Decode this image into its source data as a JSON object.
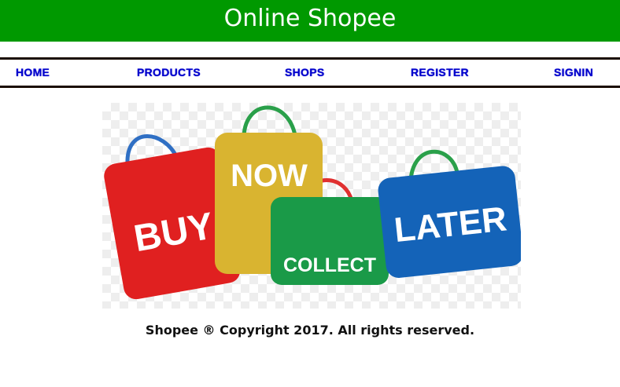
{
  "header": {
    "title": "Online Shopee",
    "bg_color": "#009900"
  },
  "nav": {
    "items": [
      {
        "label": "HOME"
      },
      {
        "label": "PRODUCTS"
      },
      {
        "label": "SHOPS"
      },
      {
        "label": "REGISTER"
      },
      {
        "label": "SIGNIN"
      }
    ],
    "link_color": "#0000cc"
  },
  "banner": {
    "bags": [
      {
        "word": "BUY",
        "color": "#e02020"
      },
      {
        "word": "NOW",
        "color": "#d9b430"
      },
      {
        "word": "COLLECT",
        "color": "#1a9a48"
      },
      {
        "word": "LATER",
        "color": "#1463b8"
      }
    ],
    "handle_colors": [
      "#2f6fc4",
      "#2aa04a",
      "#e03030",
      "#2aa04a"
    ]
  },
  "footer": {
    "text": "Shopee ® Copyright 2017. All rights reserved."
  }
}
